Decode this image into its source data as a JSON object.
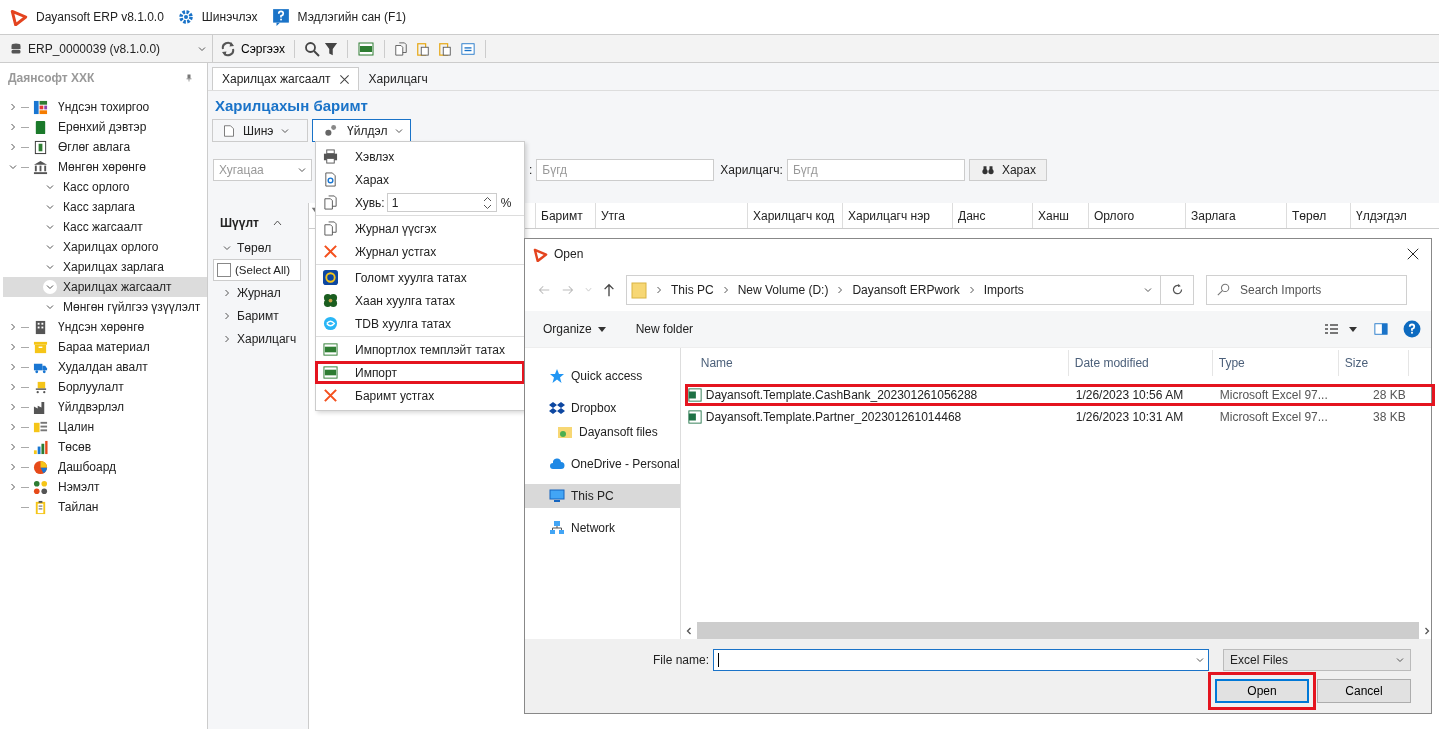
{
  "app_bar": {
    "title": "Dayansoft ERP v8.1.0.0",
    "update": "Шинэчлэх",
    "help": "Мэдлэгийн сан (F1)"
  },
  "toolbar": {
    "database": "ERP_0000039 (v8.1.0.0)",
    "refresh": "Сэргээх"
  },
  "sidebar": {
    "company": "Даянсофт ХХК",
    "items": [
      {
        "label": "Үндсэн тохиргоо",
        "expanded": false,
        "selected": false
      },
      {
        "label": "Ерөнхий дэвтэр",
        "expanded": false,
        "selected": false
      },
      {
        "label": "Өглөг авлага",
        "expanded": false,
        "selected": false
      },
      {
        "label": "Мөнгөн хөрөнгө",
        "expanded": true,
        "selected": false,
        "children": [
          {
            "label": "Касс орлого",
            "selected": false
          },
          {
            "label": "Касс зарлага",
            "selected": false
          },
          {
            "label": "Касс жагсаалт",
            "selected": false
          },
          {
            "label": "Харилцах орлого",
            "selected": false
          },
          {
            "label": "Харилцах зарлага",
            "selected": false
          },
          {
            "label": "Харилцах жагсаалт",
            "selected": true
          },
          {
            "label": "Мөнгөн гүйлгээ үзүүлэлт",
            "selected": false
          }
        ]
      },
      {
        "label": "Үндсэн хөрөнгө",
        "expanded": false,
        "selected": false
      },
      {
        "label": "Бараа материал",
        "expanded": false,
        "selected": false
      },
      {
        "label": "Худалдан авалт",
        "expanded": false,
        "selected": false
      },
      {
        "label": "Борлуулалт",
        "expanded": false,
        "selected": false
      },
      {
        "label": "Үйлдвэрлэл",
        "expanded": false,
        "selected": false
      },
      {
        "label": "Цалин",
        "expanded": false,
        "selected": false
      },
      {
        "label": "Төсөв",
        "expanded": false,
        "selected": false
      },
      {
        "label": "Дашбоард",
        "expanded": false,
        "selected": false
      },
      {
        "label": "Нэмэлт",
        "expanded": false,
        "selected": false
      },
      {
        "label": "Тайлан",
        "selected": false
      }
    ]
  },
  "tabs": [
    {
      "label": "Харилцах жагсаалт",
      "selected": true,
      "closable": true
    },
    {
      "label": "Харилцагч",
      "selected": false,
      "closable": false
    }
  ],
  "page_title": "Харилцахын баримт",
  "actions": [
    {
      "label": "Шинэ",
      "open": false
    },
    {
      "label": "Үйлдэл",
      "open": true
    }
  ],
  "filter_bar": {
    "period": {
      "placeholder": "Хугацаа"
    },
    "field_1": {
      "label": ":",
      "placeholder": "Бүгд"
    },
    "partner": {
      "label": "Харилцагч:",
      "placeholder": "Бүгд"
    },
    "view_button": "Харах"
  },
  "filter_panel": {
    "title": "Шүүлт",
    "group": "Төрөл",
    "select_all": {
      "label": "(Select All)",
      "checked": false
    },
    "fields": [
      "Журнал",
      "Баримт",
      "Харилцагч"
    ]
  },
  "table": {
    "columns": [
      "Баримт",
      "Утга",
      "Харилцагч код",
      "Харилцагч нэр",
      "Данс",
      "Ханш",
      "Орлого",
      "Зарлага",
      "Төрөл",
      "Үлдэгдэл"
    ]
  },
  "action_menu": {
    "groups": [
      [
        {
          "kind": "item",
          "label": "Хэвлэх",
          "highlighted": false
        },
        {
          "kind": "item",
          "label": "Харах",
          "highlighted": false
        },
        {
          "kind": "percent",
          "label": "Хувь:",
          "value": "1",
          "unit": "%",
          "highlighted": false
        }
      ],
      [
        {
          "kind": "item",
          "label": "Журнал үүсгэх",
          "highlighted": false
        },
        {
          "kind": "item",
          "label": "Журнал устгах",
          "highlighted": false
        }
      ],
      [
        {
          "kind": "item",
          "label": "Голомт хуулга татах",
          "highlighted": false
        },
        {
          "kind": "item",
          "label": "Хаан хуулга татах",
          "highlighted": false
        },
        {
          "kind": "item",
          "label": "TDB хуулга татах",
          "highlighted": false
        }
      ],
      [
        {
          "kind": "item",
          "label": "Импортлох темплэйт татах",
          "highlighted": false
        },
        {
          "kind": "item",
          "label": "Импорт",
          "highlighted": true
        },
        {
          "kind": "item",
          "label": "Баримт устгах",
          "highlighted": false
        }
      ]
    ]
  },
  "open_dialog": {
    "title": "Open",
    "path": [
      "This PC",
      "New Volume (D:)",
      "Dayansoft ERPwork",
      "Imports"
    ],
    "search": {
      "placeholder": "Search Imports"
    },
    "commands": [
      "Organize",
      "New folder"
    ],
    "nav": [
      {
        "label": "Quick access",
        "selected": false
      },
      {
        "label": "Dropbox",
        "selected": false,
        "children": [
          {
            "label": "Dayansoft files",
            "selected": false
          }
        ]
      },
      {
        "label": "OneDrive - Personal",
        "selected": false
      },
      {
        "label": "This PC",
        "selected": true
      },
      {
        "label": "Network",
        "selected": false
      }
    ],
    "columns": [
      "Name",
      "Date modified",
      "Type",
      "Size"
    ],
    "files": [
      {
        "name": "Dayansoft.Template.CashBank_202301261056288",
        "date": "1/26/2023 10:56 AM",
        "type": "Microsoft Excel 97...",
        "size": "28 KB",
        "highlighted": true
      },
      {
        "name": "Dayansoft.Template.Partner_202301261014468",
        "date": "1/26/2023 10:31 AM",
        "type": "Microsoft Excel 97...",
        "size": "38 KB",
        "highlighted": false
      }
    ],
    "file_name_label": "File name:",
    "file_type": "Excel Files",
    "buttons": [
      {
        "label": "Open",
        "highlighted": true
      },
      {
        "label": "Cancel",
        "highlighted": false
      }
    ]
  }
}
